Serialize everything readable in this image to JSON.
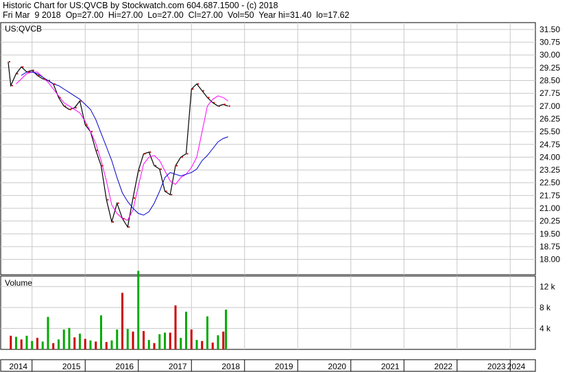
{
  "header": {
    "line1": "Historic Chart for US:QVCB by Stockwatch.com 604.687.1500 - (c) 2018",
    "line2": "Fri Mar  9 2018  Op=27.00  Hi=27.00  Lo=27.00  Cl=27.00  Vol=50  Year hi=31.40  lo=17.62"
  },
  "chart_data": [
    {
      "type": "line",
      "title": "US:QVCB",
      "ylabel": "",
      "xlabel": "",
      "ylim": [
        17.1,
        31.9
      ],
      "y_ticks": [
        "31.50",
        "30.75",
        "30.00",
        "29.25",
        "28.50",
        "27.75",
        "27.00",
        "26.25",
        "25.50",
        "24.75",
        "24.00",
        "23.25",
        "22.50",
        "21.75",
        "21.00",
        "20.25",
        "19.50",
        "18.75",
        "18.00"
      ],
      "x_ticks": [
        "2014",
        "2015",
        "2016",
        "2017",
        "2018",
        "2019",
        "2020",
        "2021",
        "2022",
        "2023",
        "2024"
      ],
      "grid": true,
      "series": [
        {
          "color": "#000000",
          "x": [
            2014.05,
            2014.1,
            2014.2,
            2014.3,
            2014.4,
            2014.5,
            2014.6,
            2014.7,
            2014.8,
            2014.9,
            2015.0,
            2015.1,
            2015.2,
            2015.3,
            2015.4,
            2015.5,
            2015.6,
            2015.7,
            2015.8,
            2015.9,
            2016.0,
            2016.1,
            2016.2,
            2016.3,
            2016.4,
            2016.5,
            2016.6,
            2016.7,
            2016.8,
            2016.9,
            2017.0,
            2017.1,
            2017.2,
            2017.3,
            2017.4,
            2017.5,
            2017.6,
            2017.7,
            2017.8,
            2017.9,
            2018.0,
            2018.1,
            2018.19
          ],
          "values": [
            29.6,
            28.2,
            28.9,
            29.3,
            29.0,
            29.1,
            28.8,
            28.6,
            28.5,
            28.3,
            27.5,
            27.0,
            26.8,
            26.9,
            27.3,
            25.9,
            25.5,
            24.4,
            23.5,
            21.5,
            20.2,
            21.3,
            20.4,
            19.9,
            21.6,
            23.2,
            24.2,
            24.3,
            23.5,
            23.3,
            22.0,
            21.8,
            23.5,
            24.0,
            24.2,
            28.0,
            28.3,
            27.9,
            27.5,
            27.2,
            27.0,
            27.1,
            27.0
          ]
        },
        {
          "color": "#ff00ff",
          "x": [
            2014.2,
            2014.3,
            2014.4,
            2014.5,
            2014.6,
            2014.7,
            2014.8,
            2014.9,
            2015.0,
            2015.1,
            2015.2,
            2015.3,
            2015.4,
            2015.5,
            2015.6,
            2015.7,
            2015.8,
            2015.9,
            2016.0,
            2016.1,
            2016.2,
            2016.3,
            2016.4,
            2016.5,
            2016.6,
            2016.7,
            2016.8,
            2016.9,
            2017.0,
            2017.1,
            2017.2,
            2017.3,
            2017.4,
            2017.5,
            2017.6,
            2017.7,
            2017.8,
            2017.9,
            2018.0,
            2018.1,
            2018.19
          ],
          "values": [
            28.3,
            28.6,
            28.9,
            29.0,
            29.0,
            28.7,
            28.4,
            28.0,
            27.6,
            27.2,
            27.0,
            26.8,
            26.6,
            26.1,
            25.5,
            24.8,
            23.8,
            22.6,
            21.2,
            20.7,
            20.4,
            20.3,
            20.9,
            22.3,
            23.6,
            24.0,
            24.1,
            23.8,
            23.2,
            22.6,
            22.4,
            22.8,
            23.0,
            23.4,
            24.0,
            25.5,
            27.0,
            27.4,
            27.6,
            27.5,
            27.3
          ]
        },
        {
          "color": "#0000cc",
          "x": [
            2014.3,
            2014.4,
            2014.5,
            2014.6,
            2014.7,
            2014.8,
            2014.9,
            2015.0,
            2015.1,
            2015.2,
            2015.3,
            2015.4,
            2015.5,
            2015.6,
            2015.7,
            2015.8,
            2015.9,
            2016.0,
            2016.1,
            2016.2,
            2016.3,
            2016.4,
            2016.5,
            2016.6,
            2016.7,
            2016.8,
            2016.9,
            2017.0,
            2017.1,
            2017.2,
            2017.3,
            2017.4,
            2017.5,
            2017.6,
            2017.7,
            2017.8,
            2017.9,
            2018.0,
            2018.1,
            2018.19
          ],
          "values": [
            28.8,
            29.0,
            29.0,
            28.9,
            28.7,
            28.5,
            28.3,
            28.2,
            28.0,
            27.8,
            27.6,
            27.4,
            27.1,
            26.8,
            26.2,
            25.4,
            24.6,
            23.8,
            22.8,
            21.9,
            21.4,
            21.0,
            20.7,
            20.6,
            20.8,
            21.3,
            22.0,
            22.8,
            23.1,
            23.0,
            22.9,
            23.0,
            23.1,
            23.3,
            23.8,
            24.1,
            24.5,
            24.9,
            25.1,
            25.2
          ]
        }
      ]
    },
    {
      "type": "bar",
      "title": "Volume",
      "ylim": [
        0,
        14000
      ],
      "y_ticks": [
        "12 k",
        "8 k",
        "4 k"
      ],
      "x": [
        2014.1,
        2014.2,
        2014.3,
        2014.4,
        2014.5,
        2014.6,
        2014.7,
        2014.8,
        2014.9,
        2015.0,
        2015.1,
        2015.2,
        2015.3,
        2015.4,
        2015.5,
        2015.6,
        2015.7,
        2015.8,
        2015.9,
        2016.0,
        2016.1,
        2016.2,
        2016.3,
        2016.4,
        2016.5,
        2016.6,
        2016.7,
        2016.8,
        2016.9,
        2017.0,
        2017.1,
        2017.2,
        2017.3,
        2017.4,
        2017.5,
        2017.6,
        2017.7,
        2017.8,
        2017.9,
        2018.0,
        2018.1,
        2018.15
      ],
      "values": [
        2600,
        2400,
        1900,
        2600,
        1600,
        2200,
        1500,
        6200,
        1200,
        1900,
        3800,
        4100,
        2300,
        3000,
        2000,
        1700,
        1500,
        6500,
        1400,
        1700,
        3800,
        10800,
        3900,
        3400,
        15000,
        3500,
        1800,
        1200,
        2900,
        3200,
        3200,
        8400,
        2200,
        7200,
        3800,
        1800,
        1600,
        6300,
        1300,
        2700,
        3400,
        7600
      ],
      "colors": [
        "#cc0000",
        "#00aa00",
        "#cc0000",
        "#00aa00",
        "#00aa00",
        "#cc0000",
        "#00aa00",
        "#00aa00",
        "#cc0000",
        "#00aa00",
        "#00aa00",
        "#00aa00",
        "#cc0000",
        "#00aa00",
        "#cc0000",
        "#00aa00",
        "#cc0000",
        "#00aa00",
        "#cc0000",
        "#00aa00",
        "#00aa00",
        "#cc0000",
        "#00aa00",
        "#cc0000",
        "#00aa00",
        "#cc0000",
        "#00aa00",
        "#cc0000",
        "#00aa00",
        "#00aa00",
        "#cc0000",
        "#cc0000",
        "#00aa00",
        "#00aa00",
        "#cc0000",
        "#00aa00",
        "#cc0000",
        "#00aa00",
        "#cc0000",
        "#00aa00",
        "#cc0000",
        "#00aa00"
      ]
    }
  ]
}
